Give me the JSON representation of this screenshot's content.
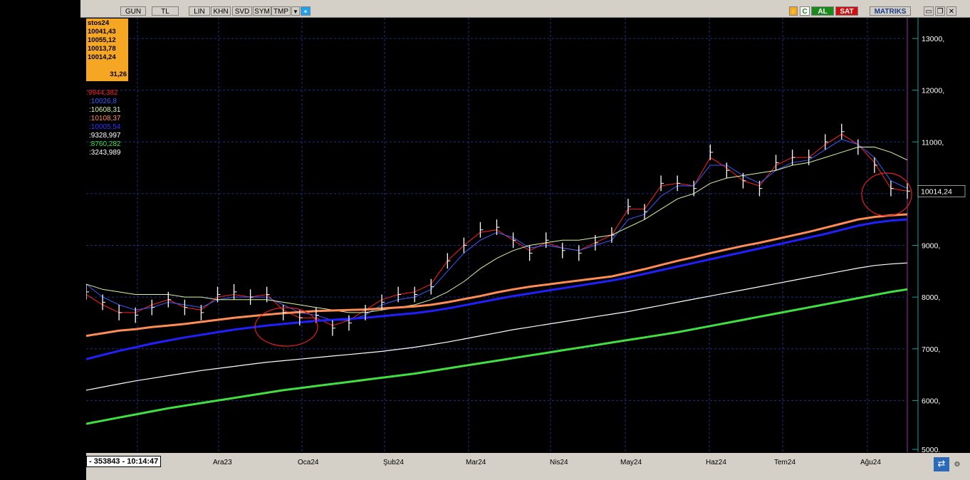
{
  "toolbar": {
    "buttons": [
      "GUN",
      "TL",
      "LIN",
      "KHN",
      "SVD",
      "SYM",
      "TMP"
    ],
    "buy_label": "AL",
    "sell_label": "SAT",
    "brand": "MATRIKS"
  },
  "info_panel": {
    "symbol": "stos24",
    "values": [
      "10041,43",
      "10055,12",
      "10013,78",
      "10014,24"
    ],
    "extra": "31,26"
  },
  "ma_values": [
    {
      "text": ":9944,382",
      "color": "#ff2020"
    },
    {
      "text": ":10026,8",
      "color": "#3a5cff"
    },
    {
      "text": ":10608,31",
      "color": "#d8f5a0"
    },
    {
      "text": ":10108,37",
      "color": "#ff8c55"
    },
    {
      "text": ":10005,54",
      "color": "#3030ff"
    },
    {
      "text": ":9328,997",
      "color": "#ffffff"
    },
    {
      "text": ":8760,282",
      "color": "#40e040"
    },
    {
      "text": ":3243,989",
      "color": "#ffffff"
    }
  ],
  "status": {
    "text": "- 353843 - 10:14:47"
  },
  "chart_data": {
    "type": "line",
    "last_price_label": "10014,24",
    "y_ticks": [
      "13000,",
      "12000,",
      "11000,",
      "10014,24",
      "9000,",
      "8000,",
      "7000,",
      "6000,",
      "5000,"
    ],
    "ylim": [
      5000,
      13400
    ],
    "x_ticks": [
      "Ara23",
      "Oca24",
      "Şub24",
      "Mar24",
      "Nis24",
      "May24",
      "Haz24",
      "Tem24",
      "Ağu24"
    ],
    "series": [
      {
        "key": "price",
        "color": "#ffffff",
        "values": [
          8100,
          7900,
          7700,
          7650,
          7800,
          7950,
          7800,
          7700,
          8050,
          8100,
          8000,
          8050,
          7700,
          7600,
          7650,
          7400,
          7500,
          7700,
          7900,
          8050,
          8050,
          8200,
          8700,
          9000,
          9300,
          9350,
          9100,
          8850,
          9100,
          8900,
          8850,
          9050,
          9200,
          9750,
          9650,
          10200,
          10200,
          10100,
          10800,
          10450,
          10250,
          10100,
          10600,
          10700,
          10700,
          11000,
          11200,
          10900,
          10550,
          10100,
          10050
        ]
      },
      {
        "key": "ma_fast",
        "color": "#ff2020",
        "values": [
          8050,
          7850,
          7700,
          7700,
          7850,
          7950,
          7800,
          7750,
          8000,
          8050,
          8000,
          8050,
          7750,
          7600,
          7600,
          7450,
          7550,
          7750,
          7950,
          8050,
          8100,
          8250,
          8700,
          9000,
          9250,
          9300,
          9100,
          8900,
          9050,
          8950,
          8900,
          9050,
          9200,
          9700,
          9700,
          10150,
          10200,
          10150,
          10700,
          10500,
          10250,
          10150,
          10550,
          10700,
          10700,
          10950,
          11150,
          10950,
          10600,
          10100,
          10050
        ]
      },
      {
        "key": "ma_short",
        "color": "#3a5cff",
        "values": [
          8250,
          8000,
          7850,
          7750,
          7800,
          7900,
          7850,
          7800,
          7950,
          8000,
          8000,
          8000,
          7850,
          7700,
          7650,
          7550,
          7550,
          7650,
          7850,
          7950,
          8000,
          8150,
          8500,
          8850,
          9100,
          9250,
          9150,
          8950,
          9000,
          8950,
          8900,
          9000,
          9100,
          9500,
          9600,
          9950,
          10150,
          10150,
          10550,
          10550,
          10350,
          10200,
          10450,
          10600,
          10650,
          10850,
          11050,
          10950,
          10700,
          10250,
          10100
        ]
      },
      {
        "key": "ma_mid",
        "color": "#d8f5a0",
        "values": [
          8250,
          8150,
          8100,
          8050,
          8050,
          8050,
          8000,
          8000,
          7950,
          7950,
          7950,
          7950,
          7900,
          7850,
          7800,
          7750,
          7700,
          7700,
          7750,
          7800,
          7850,
          7950,
          8100,
          8300,
          8550,
          8750,
          8900,
          9000,
          9050,
          9100,
          9100,
          9150,
          9200,
          9350,
          9500,
          9700,
          9900,
          10000,
          10200,
          10300,
          10350,
          10400,
          10450,
          10550,
          10600,
          10700,
          10800,
          10900,
          10900,
          10800,
          10650
        ]
      },
      {
        "key": "ma_long",
        "color": "#ff8c55",
        "values": [
          7250,
          7300,
          7350,
          7380,
          7420,
          7450,
          7480,
          7520,
          7560,
          7600,
          7630,
          7660,
          7690,
          7710,
          7730,
          7740,
          7750,
          7760,
          7780,
          7800,
          7820,
          7850,
          7900,
          7960,
          8020,
          8090,
          8150,
          8200,
          8240,
          8280,
          8320,
          8360,
          8400,
          8470,
          8540,
          8620,
          8700,
          8770,
          8850,
          8920,
          8990,
          9050,
          9120,
          9190,
          9260,
          9340,
          9420,
          9500,
          9550,
          9580,
          9600
        ]
      },
      {
        "key": "ma_longer",
        "color": "#2020ff",
        "values": [
          6800,
          6880,
          6960,
          7030,
          7100,
          7160,
          7220,
          7270,
          7320,
          7370,
          7410,
          7450,
          7480,
          7510,
          7540,
          7560,
          7580,
          7600,
          7630,
          7660,
          7690,
          7730,
          7780,
          7840,
          7900,
          7960,
          8020,
          8070,
          8120,
          8170,
          8220,
          8270,
          8320,
          8380,
          8450,
          8520,
          8590,
          8660,
          8730,
          8800,
          8870,
          8940,
          9010,
          9080,
          9150,
          9220,
          9300,
          9380,
          9440,
          9480,
          9500
        ]
      },
      {
        "key": "ma_200",
        "color": "#ffffff",
        "values": [
          6200,
          6260,
          6320,
          6380,
          6430,
          6480,
          6530,
          6580,
          6620,
          6660,
          6700,
          6740,
          6770,
          6800,
          6830,
          6860,
          6890,
          6920,
          6950,
          6990,
          7030,
          7080,
          7130,
          7190,
          7250,
          7310,
          7370,
          7420,
          7470,
          7520,
          7570,
          7620,
          7670,
          7720,
          7780,
          7840,
          7900,
          7960,
          8020,
          8080,
          8140,
          8200,
          8260,
          8320,
          8380,
          8440,
          8500,
          8560,
          8610,
          8640,
          8660
        ]
      },
      {
        "key": "ma_300",
        "color": "#40e040",
        "values": [
          5550,
          5610,
          5670,
          5730,
          5790,
          5850,
          5900,
          5950,
          6000,
          6050,
          6100,
          6150,
          6200,
          6240,
          6280,
          6320,
          6360,
          6400,
          6440,
          6480,
          6520,
          6570,
          6620,
          6670,
          6720,
          6770,
          6820,
          6870,
          6920,
          6970,
          7020,
          7070,
          7120,
          7170,
          7220,
          7270,
          7320,
          7380,
          7440,
          7500,
          7560,
          7620,
          7680,
          7740,
          7800,
          7860,
          7920,
          7980,
          8040,
          8100,
          8150
        ]
      }
    ]
  }
}
